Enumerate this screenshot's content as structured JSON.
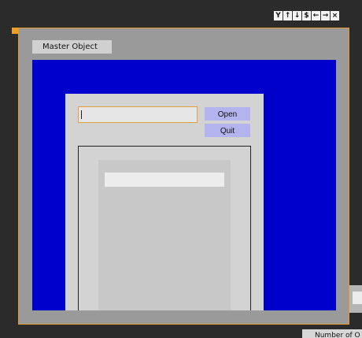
{
  "toolbar": {
    "icons": [
      {
        "name": "fork-icon",
        "glyph": "Y"
      },
      {
        "name": "arrow-up-icon",
        "glyph": "↑"
      },
      {
        "name": "arrow-down-icon",
        "glyph": "↓"
      },
      {
        "name": "dollar-icon",
        "glyph": "$"
      },
      {
        "name": "arrow-left-icon",
        "glyph": "←"
      },
      {
        "name": "arrow-right-icon",
        "glyph": "→"
      },
      {
        "name": "close-icon",
        "glyph": "×"
      }
    ]
  },
  "master": {
    "tab_label": "Master Object"
  },
  "dialog": {
    "file_input_value": "",
    "open_label": "Open",
    "quit_label": "Quit"
  },
  "footer": {
    "count_label": "Number of O"
  },
  "colors": {
    "background": "#2b2b2b",
    "window_border": "#e39a2c",
    "stage_blue": "#0000cc",
    "button_lilac": "#b3b3ee"
  }
}
